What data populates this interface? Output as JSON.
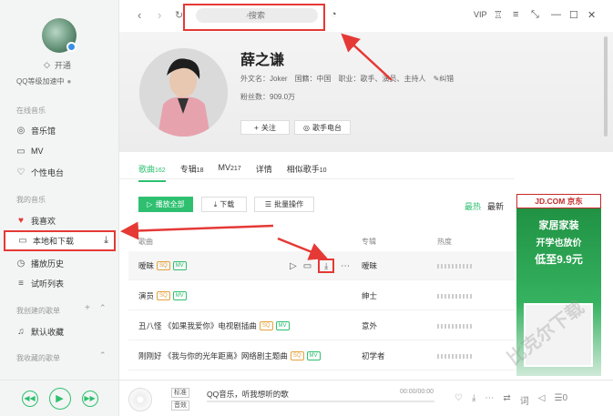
{
  "sidebar": {
    "open_label": "开通",
    "vip_speed": "QQ等级加速中",
    "sections": {
      "online": "在线音乐",
      "my_music": "我的音乐",
      "created": "我创建的歌单",
      "collected": "我收藏的歌单"
    },
    "online_items": [
      {
        "label": "音乐馆",
        "icon": "music-hall-icon"
      },
      {
        "label": "MV",
        "icon": "mv-icon"
      },
      {
        "label": "个性电台",
        "icon": "radio-icon"
      }
    ],
    "my_items": [
      {
        "label": "我喜欢",
        "icon": "heart-icon"
      },
      {
        "label": "本地和下载",
        "icon": "monitor-icon"
      },
      {
        "label": "播放历史",
        "icon": "history-icon"
      },
      {
        "label": "试听列表",
        "icon": "list-icon"
      }
    ],
    "default_playlist": "默认收藏"
  },
  "topbar": {
    "search_placeholder": "搜索",
    "vip": "VIP"
  },
  "artist": {
    "name": "薛之谦",
    "foreign_name": "外文名：Joker",
    "nationality": "国籍：中国",
    "profession": "职业：歌手、演员、主持人",
    "correction": "纠错",
    "fans": "粉丝数：909.0万",
    "follow": "关注",
    "radio": "歌手电台"
  },
  "tabs": [
    {
      "label": "歌曲",
      "count": "162"
    },
    {
      "label": "专辑",
      "count": "18"
    },
    {
      "label": "MV",
      "count": "217"
    },
    {
      "label": "详情",
      "count": ""
    },
    {
      "label": "相似歌手",
      "count": "10"
    }
  ],
  "toolbar": {
    "play_all": "播放全部",
    "download": "下载",
    "batch": "批量操作",
    "sort_hot": "最热",
    "sort_new": "最新"
  },
  "table": {
    "headers": {
      "song": "歌曲",
      "album": "专辑",
      "heat": "热度"
    },
    "rows": [
      {
        "title": "暧昧",
        "album": "暧昧"
      },
      {
        "title": "演员",
        "album": "绅士"
      },
      {
        "title": "丑八怪 《如果我爱你》电视剧插曲",
        "album": "意外"
      },
      {
        "title": "刚刚好 《我与你的光年距离》网络剧主题曲",
        "album": "初学者"
      }
    ]
  },
  "ad": {
    "brand": "JD.COM 京东",
    "line1": "家居家装",
    "line2": "开学也放价",
    "line3": "低至9.9元"
  },
  "bottom": {
    "quality": "标准",
    "effect": "音效",
    "now_playing": "QQ音乐，听我想听的歌",
    "time": "00:00/00:00",
    "count": "0"
  },
  "watermark": "比克尔下载",
  "colors": {
    "accent": "#2ec070",
    "highlight": "#e53935"
  }
}
